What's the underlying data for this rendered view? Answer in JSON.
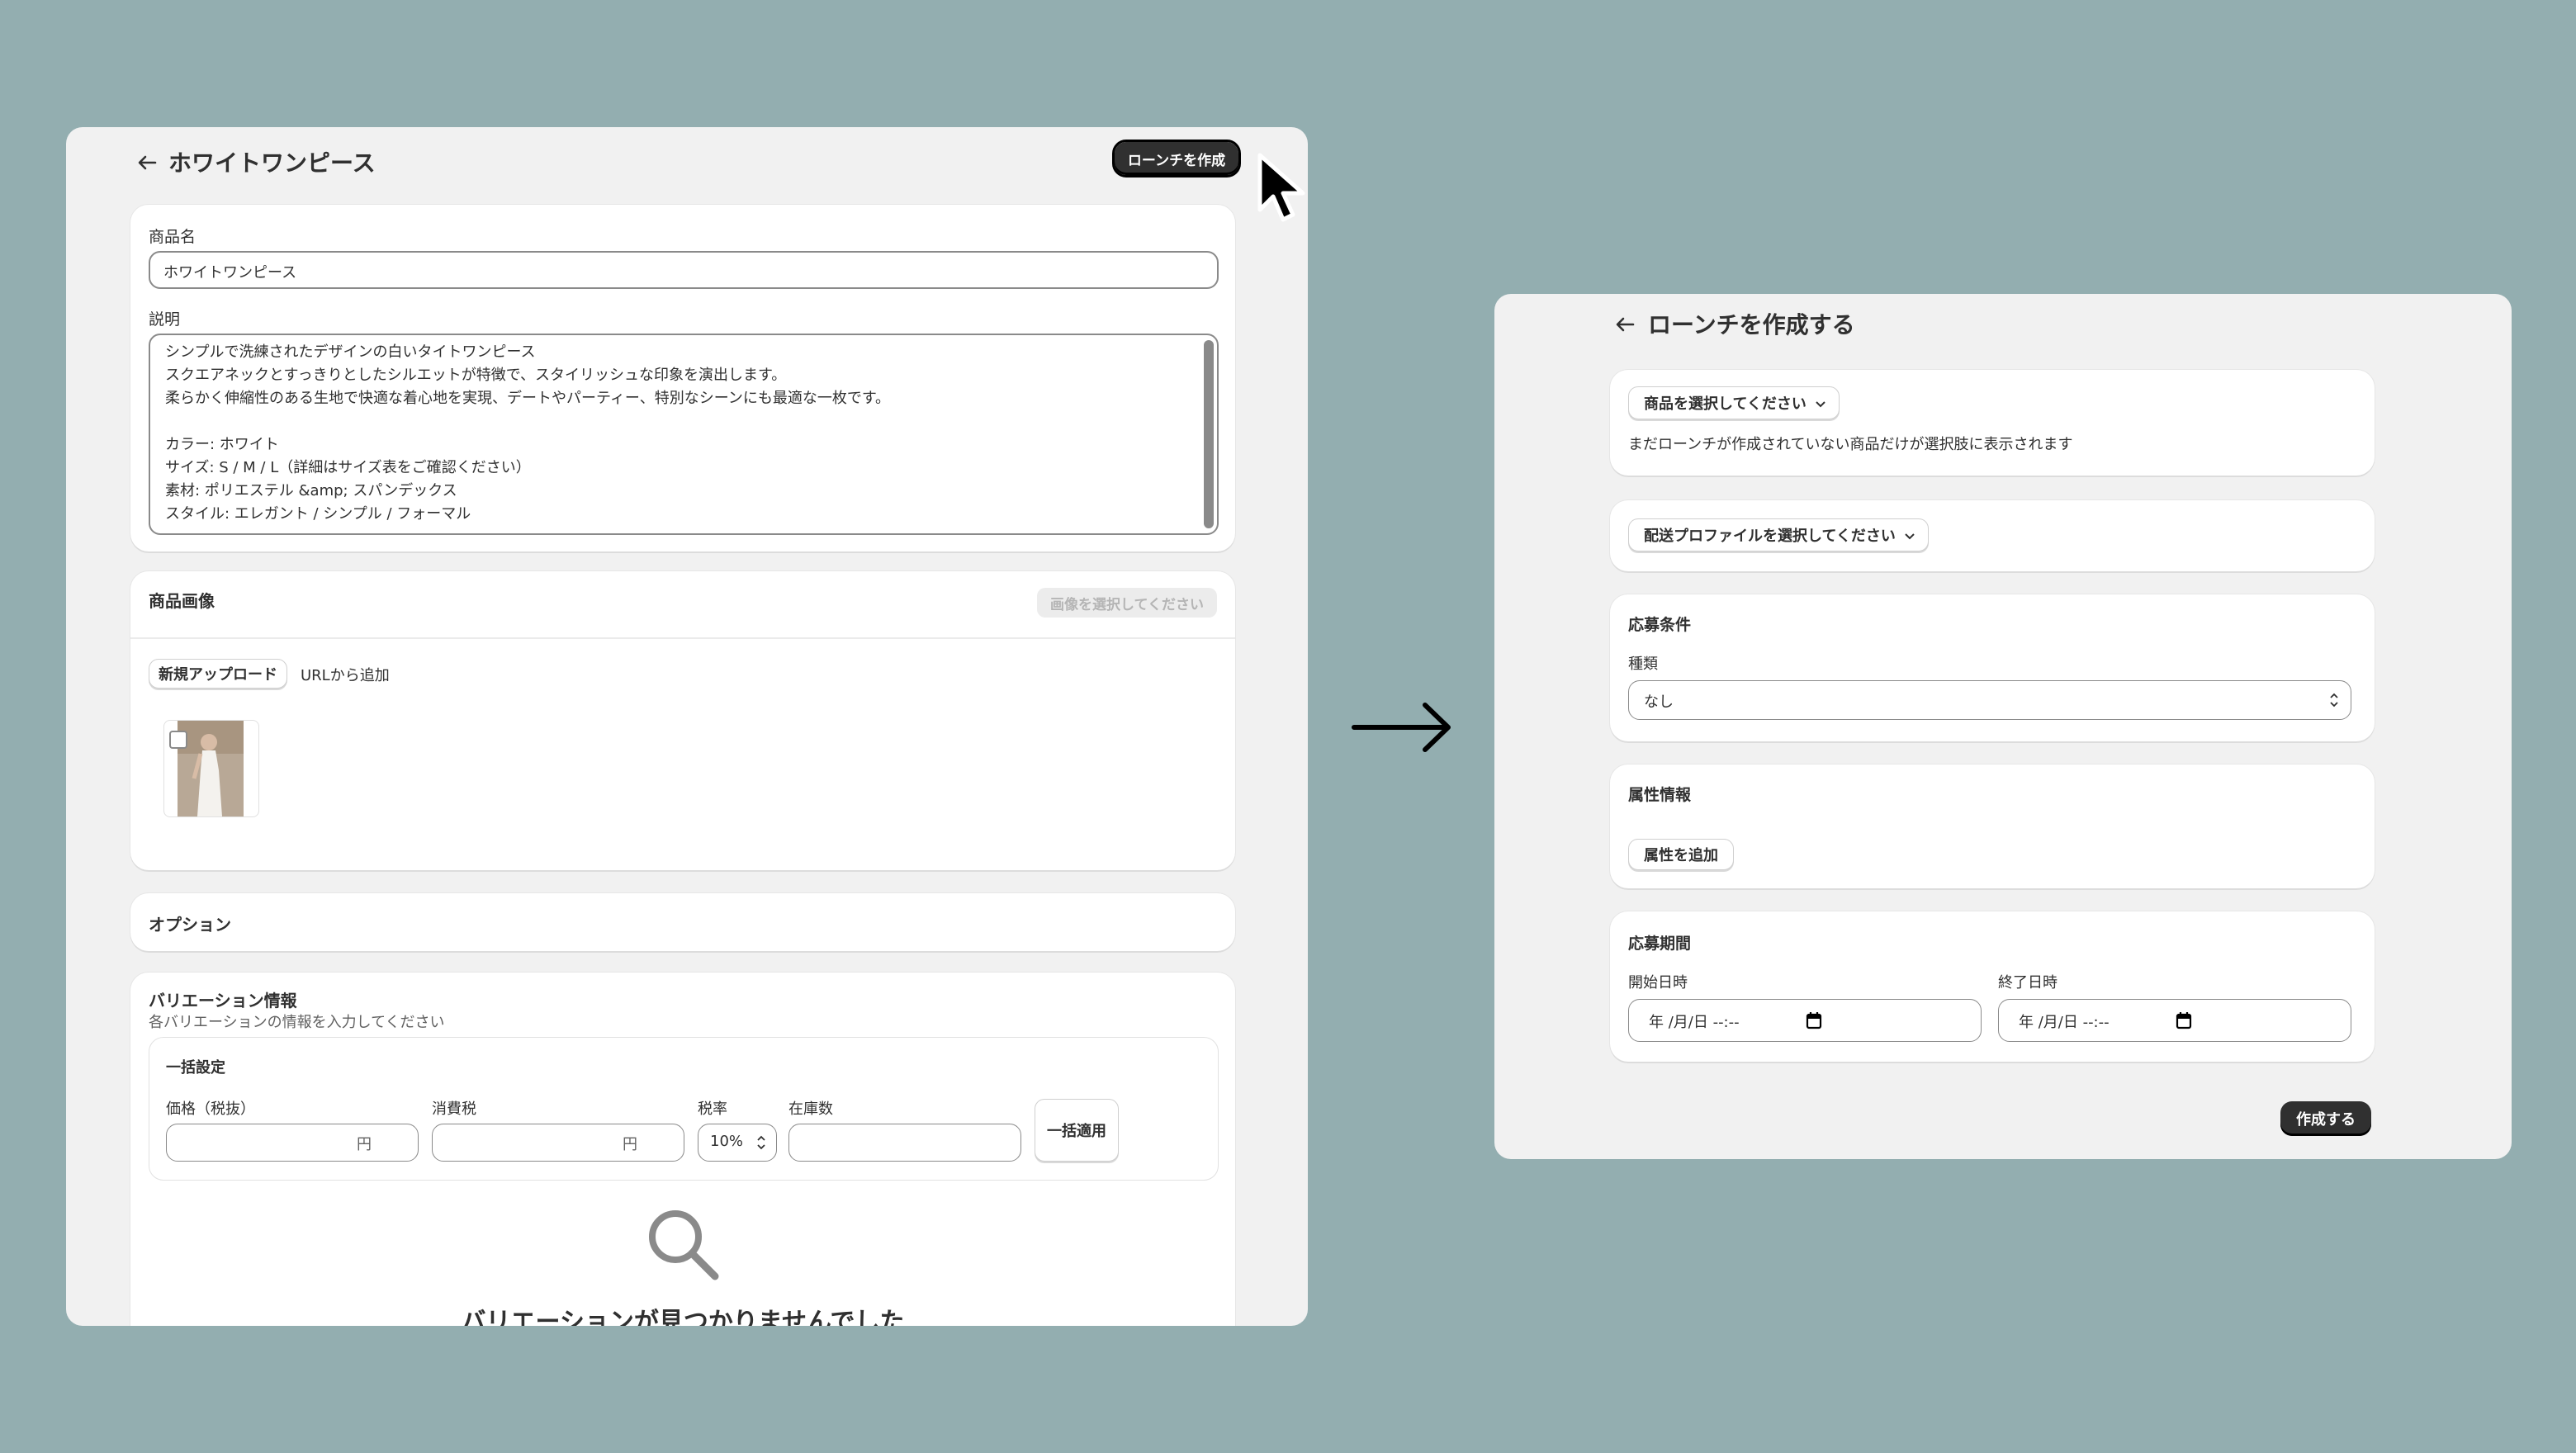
{
  "left": {
    "title": "ホワイトワンピース",
    "launch_button": "ローンチを作成",
    "product_name_label": "商品名",
    "product_name_value": "ホワイトワンピース",
    "description_label": "説明",
    "description_lines": [
      "シンプルで洗練されたデザインの白いタイトワンピース",
      "スクエアネックとすっきりとしたシルエットが特徴で、スタイリッシュな印象を演出します。",
      "柔らかく伸縮性のある生地で快適な着心地を実現、デートやパーティー、特別なシーンにも最適な一枚です。",
      "",
      "カラー: ホワイト",
      "サイズ: S / M / L（詳細はサイズ表をご確認ください）",
      "素材: ポリエステル &amp; スパンデックス",
      "スタイル: エレガント / シンプル / フォーマル"
    ],
    "images_title": "商品画像",
    "select_images_button": "画像を選択してください",
    "upload_button": "新規アップロード",
    "add_from_url": "URLから追加",
    "options_title": "オプション",
    "variation_title": "バリエーション情報",
    "variation_subtitle": "各バリエーションの情報を入力してください",
    "bulk_title": "一括設定",
    "price_label": "価格（税抜）",
    "tax_label": "消費税",
    "rate_label": "税率",
    "stock_label": "在庫数",
    "currency": "円",
    "rate_value": "10%",
    "bulk_apply_button": "一括適用",
    "empty_state": "バリエーションが見つかりませんでした"
  },
  "right": {
    "title": "ローンチを作成する",
    "select_product": "商品を選択してください",
    "product_hint": "まだローンチが作成されていない商品だけが選択肢に表示されます",
    "select_shipping": "配送プロファイルを選択してください",
    "conditions_title": "応募条件",
    "type_label": "種類",
    "type_value": "なし",
    "attributes_title": "属性情報",
    "add_attribute_button": "属性を追加",
    "period_title": "応募期間",
    "start_label": "開始日時",
    "end_label": "終了日時",
    "date_placeholder": "年 /月/日 --:--",
    "create_button": "作成する"
  }
}
